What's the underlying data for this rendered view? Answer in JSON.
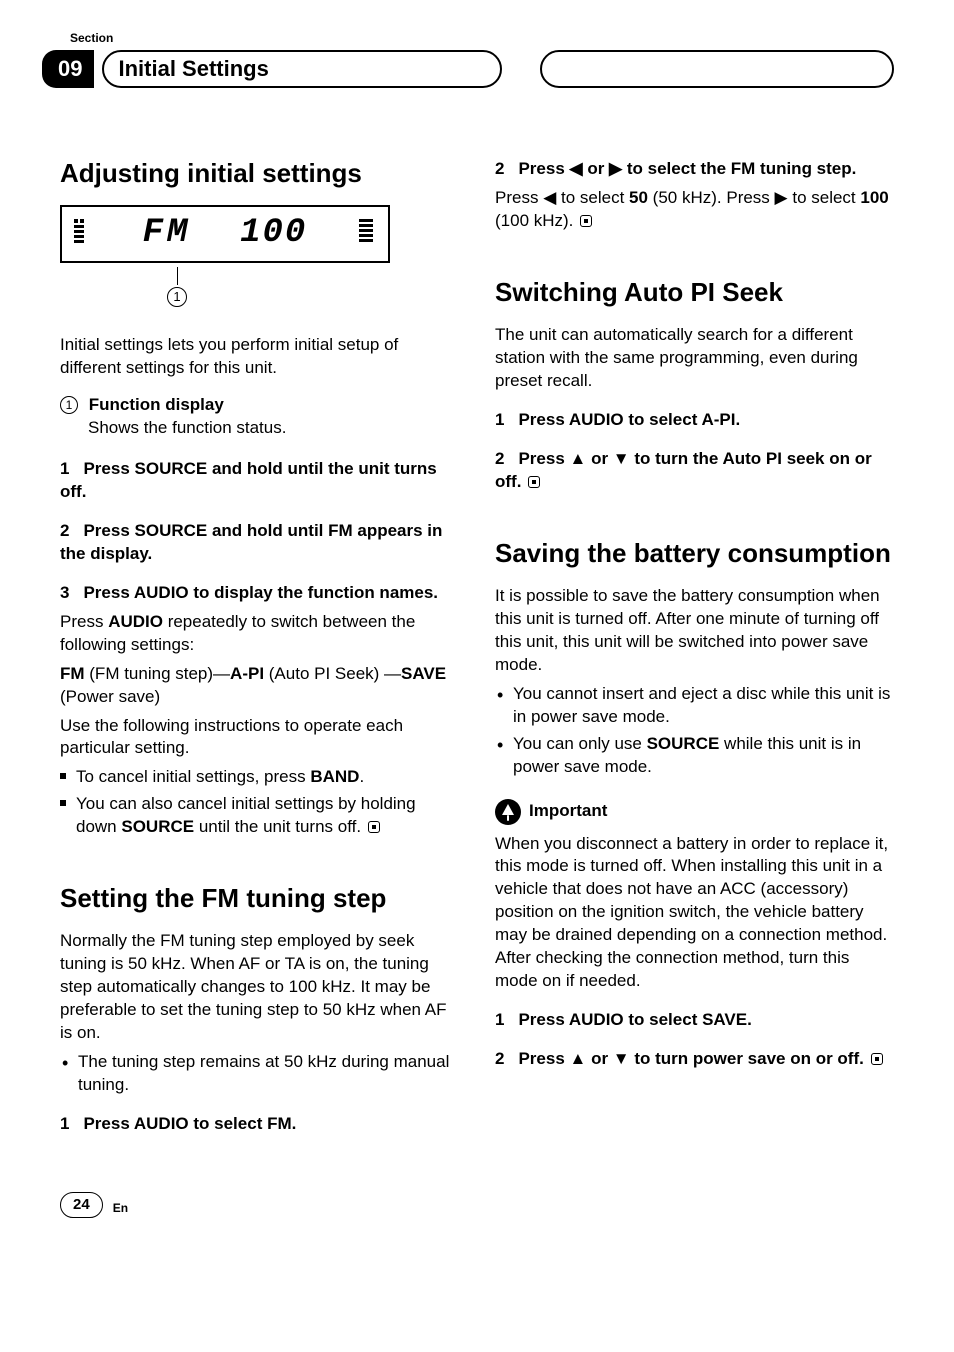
{
  "section_label": "Section",
  "chapter_number": "09",
  "chapter_title": "Initial Settings",
  "lcd": {
    "band": "FM",
    "value": "100",
    "callout": "1"
  },
  "left": {
    "h_adjusting": "Adjusting initial settings",
    "intro": "Initial settings lets you perform initial setup of different settings for this unit.",
    "func_num": "1",
    "func_title": "Function display",
    "func_body": "Shows the function status.",
    "step1_num": "1",
    "step1": "Press SOURCE and hold until the unit turns off.",
    "step2_num": "2",
    "step2": "Press SOURCE and hold until FM appears in the display.",
    "step3_num": "3",
    "step3": "Press AUDIO to display the function names.",
    "step3_body1_a": "Press ",
    "step3_body1_b": "AUDIO",
    "step3_body1_c": " repeatedly to switch between the following settings:",
    "settings_fm": "FM",
    "settings_fm_desc": " (FM tuning step)—",
    "settings_api": "A-PI",
    "settings_api_desc": " (Auto PI Seek) —",
    "settings_save": "SAVE",
    "settings_save_desc": " (Power save)",
    "step3_body2": "Use the following instructions to operate each particular setting.",
    "note1_a": "To cancel initial settings, press ",
    "note1_b": "BAND",
    "note1_c": ".",
    "note2_a": "You can also cancel initial settings by holding down ",
    "note2_b": "SOURCE",
    "note2_c": " until the unit turns off.",
    "h_fmstep": "Setting the FM tuning step",
    "fmstep_intro": "Normally the FM tuning step employed by seek tuning is 50 kHz. When AF or TA is on, the tuning step automatically changes to 100 kHz. It may be preferable to set the tuning step to 50 kHz when AF is on.",
    "fmstep_bullet": "The tuning step remains at 50 kHz during manual tuning.",
    "fmstep_step1_num": "1",
    "fmstep_step1": "Press AUDIO to select FM."
  },
  "right": {
    "fmstep_step2_num": "2",
    "fmstep_step2_a": "Press ",
    "fmstep_step2_b": " or ",
    "fmstep_step2_c": " to select the FM tuning step.",
    "fmstep_body_a": "Press ",
    "fmstep_body_b": " to select ",
    "fmstep_body_c": "50",
    "fmstep_body_d": " (50 kHz). Press ",
    "fmstep_body_e": " to select ",
    "fmstep_body_f": "100",
    "fmstep_body_g": " (100 kHz).",
    "h_autopi": "Switching Auto PI Seek",
    "autopi_intro": "The unit can automatically search for a different station with the same programming, even during preset recall.",
    "autopi_step1_num": "1",
    "autopi_step1": "Press AUDIO to select A-PI.",
    "autopi_step2_num": "2",
    "autopi_step2_a": "Press ",
    "autopi_step2_b": " or ",
    "autopi_step2_c": " to turn the Auto PI seek on or off.",
    "h_save": "Saving the battery consumption",
    "save_intro": "It is possible to save the battery consumption when this unit is turned off. After one minute of turning off this unit, this unit will be switched into power save mode.",
    "save_b1": "You cannot insert and eject a disc while this unit is in power save mode.",
    "save_b2_a": "You can only use ",
    "save_b2_b": "SOURCE",
    "save_b2_c": " while this unit is in power save mode.",
    "important_label": "Important",
    "important_body": "When you disconnect a battery in order to replace it, this mode is turned off. When installing this unit in a vehicle that does not have an ACC (accessory) position on the ignition switch, the vehicle battery may be drained depending on a connection method. After checking the connection method, turn this mode on if needed.",
    "save_step1_num": "1",
    "save_step1": "Press AUDIO to select SAVE.",
    "save_step2_num": "2",
    "save_step2_a": "Press ",
    "save_step2_b": " or ",
    "save_step2_c": " to turn power save on or off."
  },
  "footer": {
    "page": "24",
    "lang": "En"
  },
  "glyph": {
    "left": "◀",
    "right": "▶",
    "up": "▲",
    "down": "▼"
  }
}
